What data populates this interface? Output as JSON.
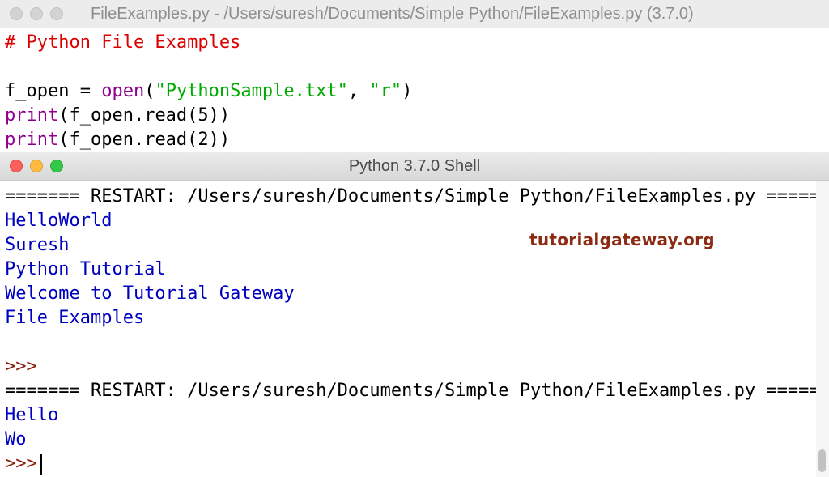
{
  "editor": {
    "title": "FileExamples.py - /Users/suresh/Documents/Simple Python/FileExamples.py (3.7.0)",
    "lines": [
      {
        "parts": [
          {
            "text": "# Python File Examples",
            "cls": "comment"
          }
        ]
      },
      {
        "parts": [
          {
            "text": "",
            "cls": ""
          }
        ]
      },
      {
        "parts": [
          {
            "text": "f_open = ",
            "cls": ""
          },
          {
            "text": "open",
            "cls": "builtin"
          },
          {
            "text": "(",
            "cls": ""
          },
          {
            "text": "\"PythonSample.txt\"",
            "cls": "string"
          },
          {
            "text": ", ",
            "cls": ""
          },
          {
            "text": "\"r\"",
            "cls": "string"
          },
          {
            "text": ")",
            "cls": ""
          }
        ]
      },
      {
        "parts": [
          {
            "text": "print",
            "cls": "builtin"
          },
          {
            "text": "(f_open.read(5))",
            "cls": ""
          }
        ]
      },
      {
        "parts": [
          {
            "text": "print",
            "cls": "builtin"
          },
          {
            "text": "(f_open.read(2))",
            "cls": ""
          }
        ]
      }
    ]
  },
  "shell": {
    "title": "Python 3.7.0 Shell",
    "watermark": "tutorialgateway.org",
    "lines": [
      {
        "parts": [
          {
            "text": "======= RESTART: /Users/suresh/Documents/Simple Python/FileExamples.py =======",
            "cls": ""
          }
        ]
      },
      {
        "parts": [
          {
            "text": "HelloWorld",
            "cls": "out"
          }
        ]
      },
      {
        "parts": [
          {
            "text": "Suresh",
            "cls": "out"
          }
        ]
      },
      {
        "parts": [
          {
            "text": "Python Tutorial",
            "cls": "out"
          }
        ]
      },
      {
        "parts": [
          {
            "text": "Welcome to Tutorial Gateway",
            "cls": "out"
          }
        ]
      },
      {
        "parts": [
          {
            "text": "File Examples",
            "cls": "out"
          }
        ]
      },
      {
        "parts": [
          {
            "text": "",
            "cls": ""
          }
        ]
      },
      {
        "parts": [
          {
            "text": ">>>",
            "cls": "prompt"
          }
        ]
      },
      {
        "parts": [
          {
            "text": "======= RESTART: /Users/suresh/Documents/Simple Python/FileExamples.py =======",
            "cls": ""
          }
        ]
      },
      {
        "parts": [
          {
            "text": "Hello",
            "cls": "out"
          }
        ]
      },
      {
        "parts": [
          {
            "text": "Wo",
            "cls": "out"
          }
        ]
      },
      {
        "parts": [
          {
            "text": ">>>",
            "cls": "prompt"
          }
        ],
        "caret": true
      }
    ]
  }
}
